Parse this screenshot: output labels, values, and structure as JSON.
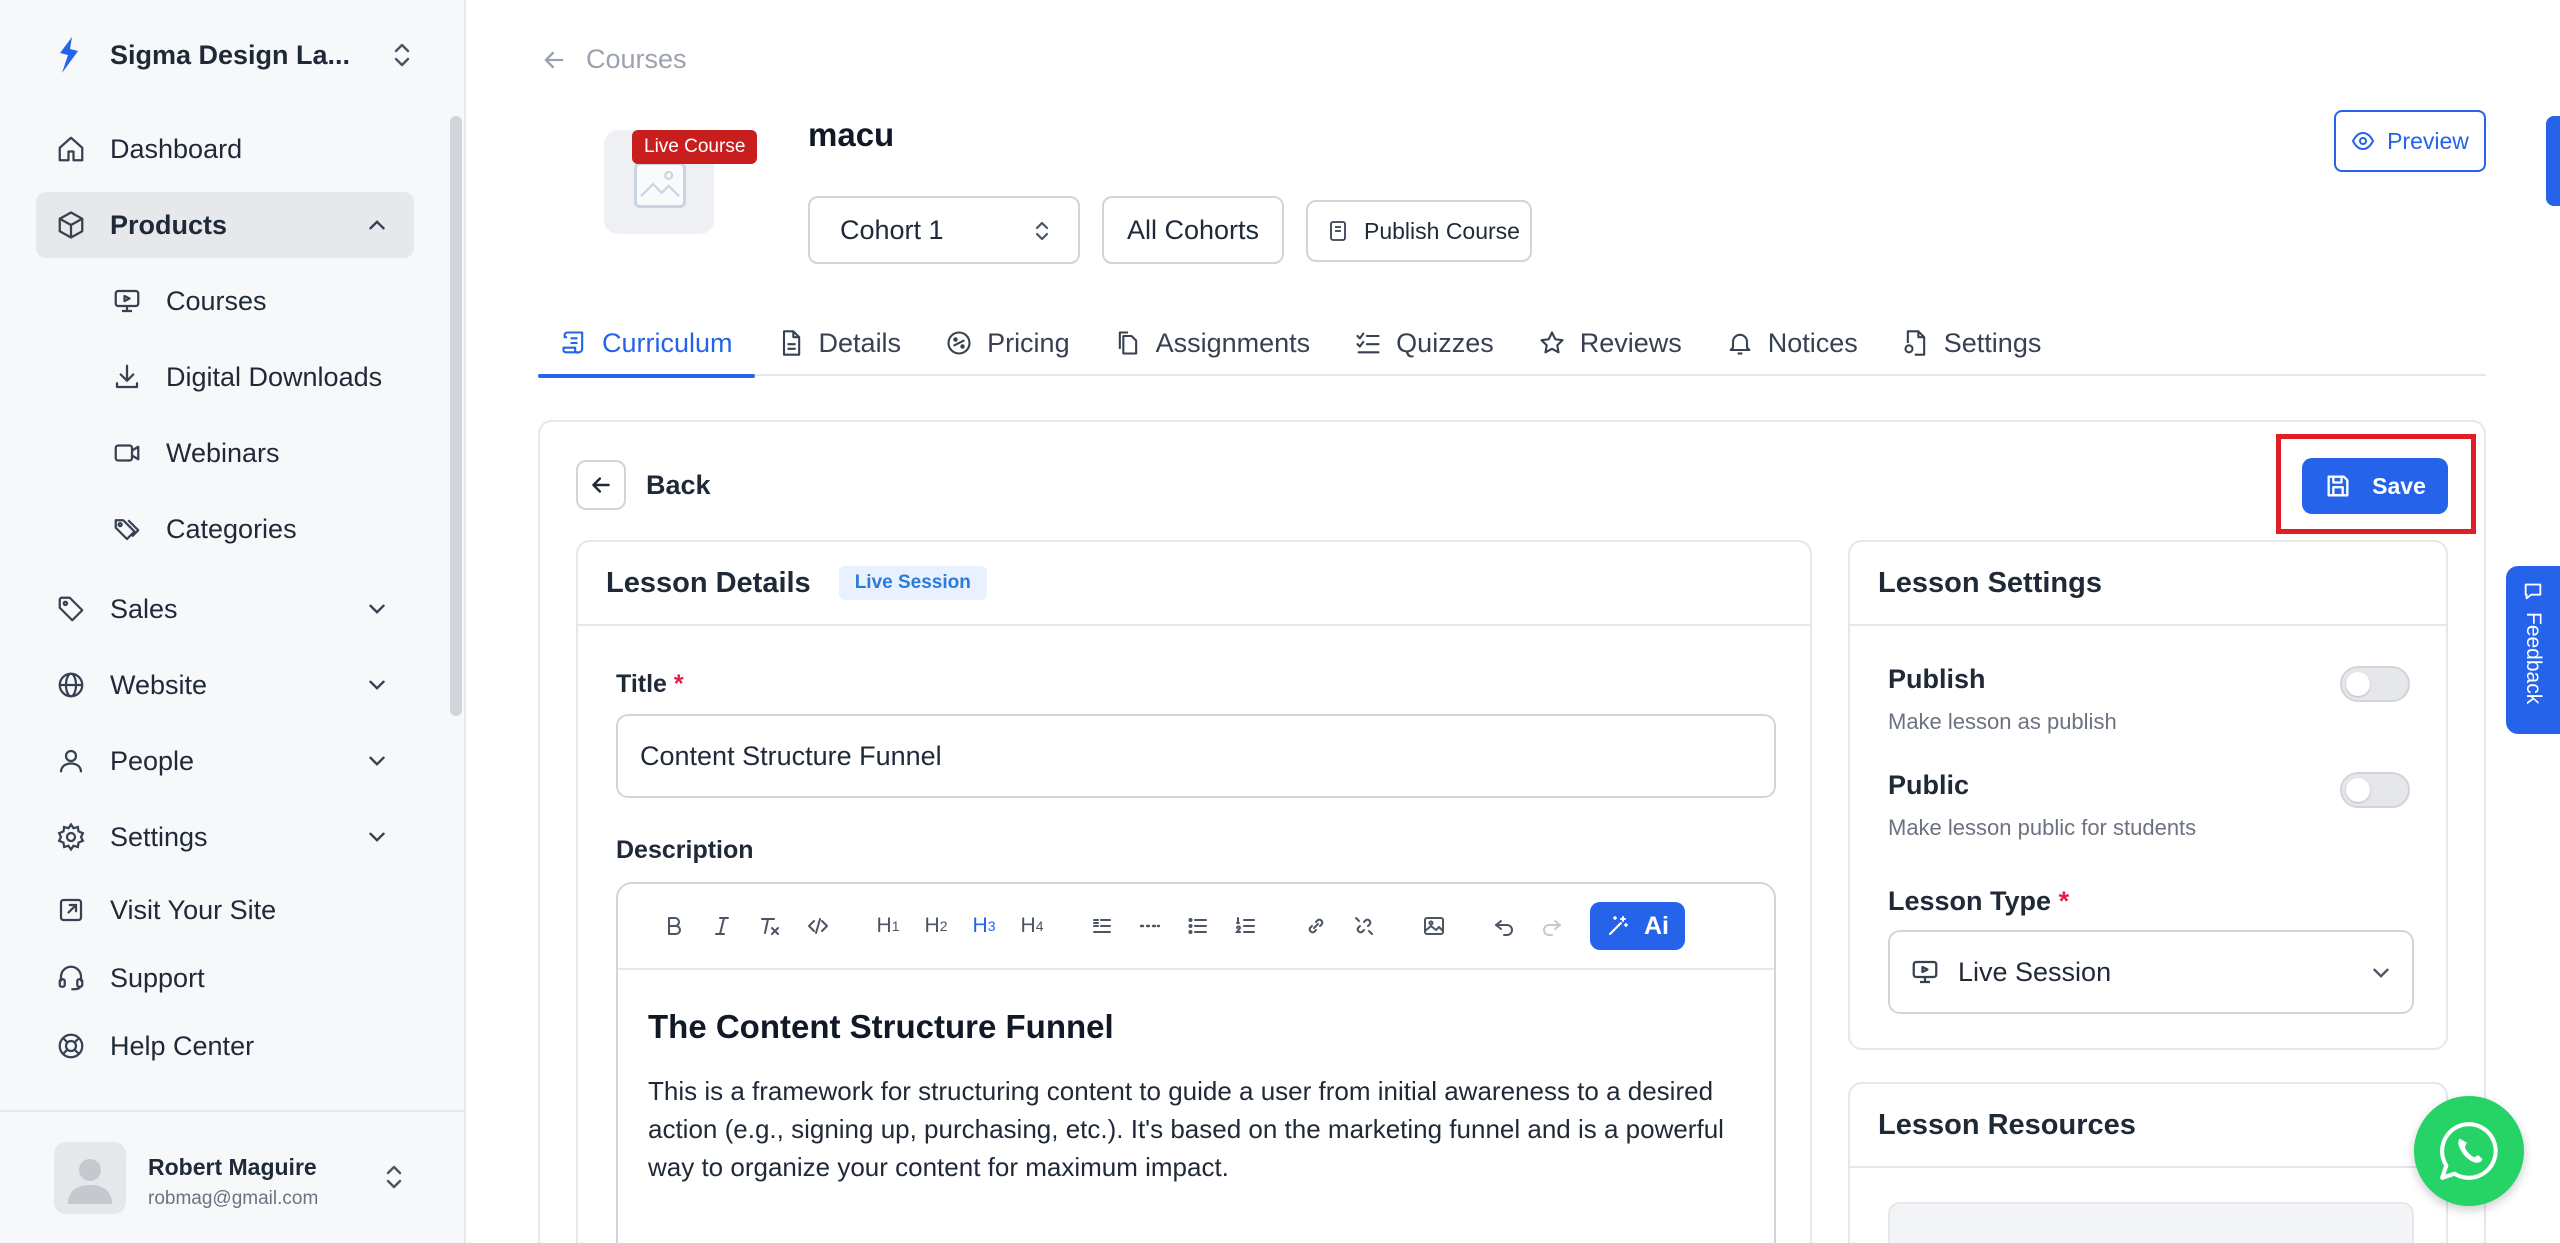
{
  "workspace": {
    "name": "Sigma Design La..."
  },
  "sidebar": {
    "items": [
      {
        "label": "Dashboard",
        "icon": "home-icon"
      },
      {
        "label": "Products",
        "icon": "box-icon"
      },
      {
        "label": "Courses",
        "icon": "monitor-icon"
      },
      {
        "label": "Digital Downloads",
        "icon": "download-icon"
      },
      {
        "label": "Webinars",
        "icon": "video-icon"
      },
      {
        "label": "Categories",
        "icon": "tags-icon"
      },
      {
        "label": "Sales",
        "icon": "tag-icon"
      },
      {
        "label": "Website",
        "icon": "globe-icon"
      },
      {
        "label": "People",
        "icon": "user-icon"
      },
      {
        "label": "Settings",
        "icon": "gear-icon"
      },
      {
        "label": "Visit Your Site",
        "icon": "external-link-icon"
      },
      {
        "label": "Support",
        "icon": "headset-icon"
      },
      {
        "label": "Help Center",
        "icon": "lifebuoy-icon"
      }
    ]
  },
  "user": {
    "name": "Robert Maguire",
    "email": "robmag@gmail.com"
  },
  "breadcrumb": {
    "label": "Courses"
  },
  "course": {
    "badge": "Live Course",
    "title": "macu",
    "cohort_selected": "Cohort 1",
    "all_cohorts_label": "All Cohorts",
    "publish_label": "Publish Course",
    "preview_label": "Preview"
  },
  "tabs": [
    {
      "label": "Curriculum",
      "icon": "curriculum-icon"
    },
    {
      "label": "Details",
      "icon": "document-icon"
    },
    {
      "label": "Pricing",
      "icon": "pricing-icon"
    },
    {
      "label": "Assignments",
      "icon": "copy-icon"
    },
    {
      "label": "Quizzes",
      "icon": "checklist-icon"
    },
    {
      "label": "Reviews",
      "icon": "star-icon"
    },
    {
      "label": "Notices",
      "icon": "bell-icon"
    },
    {
      "label": "Settings",
      "icon": "file-gear-icon"
    }
  ],
  "editor_page": {
    "back_label": "Back",
    "save_label": "Save"
  },
  "lesson_details": {
    "heading": "Lesson Details",
    "badge": "Live Session",
    "title_label": "Title",
    "required_mark": "*",
    "title_value": "Content Structure Funnel",
    "description_label": "Description",
    "toolbar": {
      "h1": "H",
      "h1_sub": "1",
      "h2": "H",
      "h2_sub": "2",
      "h3": "H",
      "h3_sub": "3",
      "h4": "H",
      "h4_sub": "4",
      "ai_label": "Ai"
    },
    "content_heading": "The Content Structure Funnel",
    "content_paragraph": "This is a framework for structuring content to guide a user from initial awareness to a desired action (e.g., signing up, purchasing, etc.). It's based on the marketing funnel and is a powerful way to organize your content for maximum impact."
  },
  "lesson_settings": {
    "heading": "Lesson Settings",
    "publish_title": "Publish",
    "publish_sub": "Make lesson as publish",
    "publish_on": false,
    "public_title": "Public",
    "public_sub": "Make lesson public for students",
    "public_on": false,
    "type_label": "Lesson Type",
    "type_value": "Live Session"
  },
  "lesson_resources": {
    "heading": "Lesson Resources"
  },
  "feedback": {
    "label": "Feedback"
  },
  "colors": {
    "accent": "#2563eb",
    "badge_red": "#c81e1e",
    "highlight": "#e11d25",
    "whatsapp": "#25d366"
  }
}
